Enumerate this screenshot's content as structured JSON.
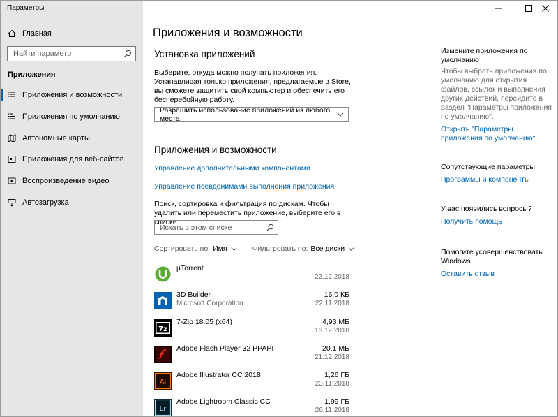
{
  "window": {
    "title": "Параметры"
  },
  "sidebar": {
    "home_label": "Главная",
    "search_placeholder": "Найти параметр",
    "section_title": "Приложения",
    "items": [
      {
        "label": "Приложения и возможности",
        "icon": "list-icon",
        "active": true
      },
      {
        "label": "Приложения по умолчанию",
        "icon": "default-apps-icon",
        "active": false
      },
      {
        "label": "Автономные карты",
        "icon": "map-icon",
        "active": false
      },
      {
        "label": "Приложения для веб-сайтов",
        "icon": "web-apps-icon",
        "active": false
      },
      {
        "label": "Воспроизведение видео",
        "icon": "video-icon",
        "active": false
      },
      {
        "label": "Автозагрузка",
        "icon": "startup-icon",
        "active": false
      }
    ]
  },
  "main": {
    "page_title": "Приложения и возможности",
    "install": {
      "heading": "Установка приложений",
      "description": "Выберите, откуда можно получать приложения. Устанавливая только приложения, предлагаемые в Store, вы сможете защитить свой компьютер и обеспечить его бесперебойную работу.",
      "dropdown_value": "Разрешить использование приложений из любого места"
    },
    "apps": {
      "heading": "Приложения и возможности",
      "link_optional": "Управление дополнительными компонентами",
      "link_aliases": "Управление псевдонимами выполнения приложения",
      "search_description": "Поиск, сортировка и фильтрация по дискам. Чтобы удалить или переместить приложение, выберите его в списке.",
      "search_placeholder": "Искать в этом списке",
      "sort_label": "Сортировать по:",
      "sort_value": "Имя",
      "filter_label": "Фильтровать по:",
      "filter_value": "Все диски"
    },
    "app_list": [
      {
        "name": "µTorrent",
        "publisher": "",
        "size": "",
        "date": "22.12.2018",
        "icon": "utorrent-icon"
      },
      {
        "name": "3D Builder",
        "publisher": "Microsoft Corporation",
        "size": "16,0 КБ",
        "date": "22.11.2018",
        "icon": "3d-builder-icon"
      },
      {
        "name": "7-Zip 18.05 (x64)",
        "publisher": "",
        "size": "4,93 МБ",
        "date": "16.12.2018",
        "icon": "7zip-icon"
      },
      {
        "name": "Adobe Flash Player 32 PPAPI",
        "publisher": "",
        "size": "20,1 МБ",
        "date": "21.12.2018",
        "icon": "flash-icon"
      },
      {
        "name": "Adobe Illustrator CC 2018",
        "publisher": "",
        "size": "1,26 ГБ",
        "date": "23.11.2018",
        "icon": "illustrator-icon"
      },
      {
        "name": "Adobe Lightroom Classic CC",
        "publisher": "",
        "size": "1,99 ГБ",
        "date": "26.11.2018",
        "icon": "lightroom-icon"
      }
    ]
  },
  "right": {
    "defaults_heading": "Измените приложения по умолчанию",
    "defaults_text": "Чтобы выбрать приложения по умолчанию для открытия файлов, ссылок и выполнения других действий, перейдите в раздел \"Параметры приложения по умолчанию\".",
    "defaults_link": "Открыть \"Параметры приложения по умолчанию\"",
    "related_heading": "Сопутствующие параметры",
    "related_link": "Программы и компоненты",
    "help_heading": "У вас появились вопросы?",
    "help_link": "Получить помощь",
    "feedback_heading": "Помогите усовершенствовать Windows",
    "feedback_link": "Оставить отзыв"
  },
  "colors": {
    "accent": "#0063b1",
    "sidebar_bg": "#e6e6e6"
  }
}
